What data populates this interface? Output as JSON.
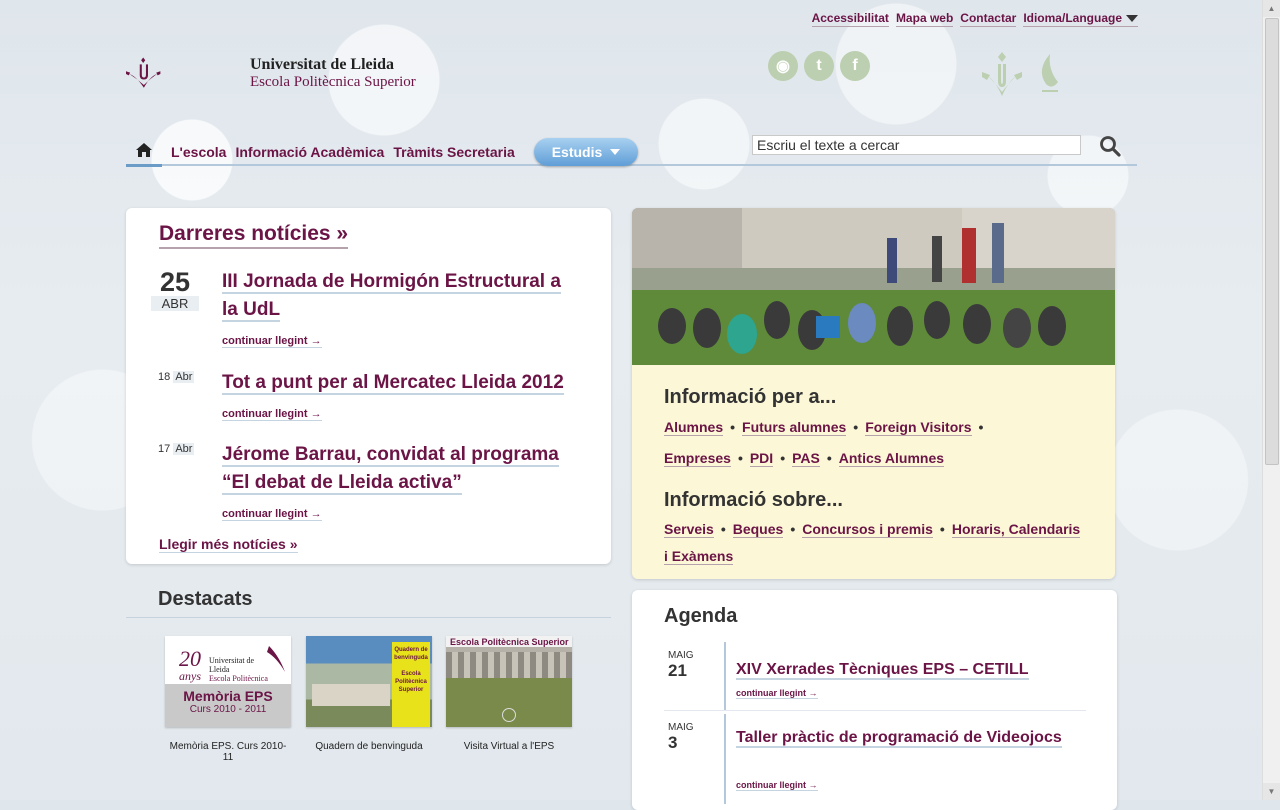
{
  "top_nav": {
    "items": [
      "Accessibilitat",
      "Mapa web",
      "Contactar",
      "Idioma/Language"
    ]
  },
  "logo": {
    "title": "Universitat de Lleida",
    "subtitle": "Escola Politècnica Superior"
  },
  "social": {
    "icons": [
      "rss-icon",
      "twitter-icon",
      "facebook-icon"
    ],
    "rss_glyph": "◉",
    "twitter_glyph": "t",
    "facebook_glyph": "f"
  },
  "main_nav": {
    "items": [
      "L'escola",
      "Informació Acadèmica",
      "Tràmits Secretaria"
    ],
    "estudis_label": "Estudis"
  },
  "search": {
    "value": "Escriu el texte a cercar"
  },
  "news": {
    "heading": "Darreres notícies »",
    "items": [
      {
        "day": "25",
        "month": "ABR",
        "title": "III Jornada de Hormigón Estructural a la UdL",
        "link": "continuar llegint →"
      },
      {
        "day": "18",
        "month": "Abr",
        "title": "Tot a punt per al Mercatec Lleida 2012",
        "link": "continuar llegint →"
      },
      {
        "day": "17",
        "month": "Abr",
        "title": "Jérome Barrau, convidat al programa “El debat de Lleida activa”",
        "link": "continuar llegint →"
      }
    ],
    "more": "Llegir més notícies »"
  },
  "info": {
    "per_heading": "Informació per a...",
    "per_links": [
      "Alumnes",
      "Futurs alumnes",
      "Foreign Visitors",
      "Empreses",
      "PDI",
      "PAS",
      "Antics Alumnes"
    ],
    "sobre_heading": "Informació sobre...",
    "sobre_links": [
      "Serveis",
      "Beques",
      "Concursos i premis",
      "Horaris, Calendaris i Exàmens"
    ]
  },
  "destacats": {
    "heading": "Destacats",
    "items": [
      {
        "caption": "Memòria EPS. Curs 2010-11",
        "img_years": "20",
        "img_anys": "anys",
        "img_title": "Memòria EPS",
        "img_sub": "Curs 2010 - 2011",
        "img_uni": "Universitat de Lleida",
        "img_school": "Escola Politècnica Superior"
      },
      {
        "caption": "Quadern de benvinguda",
        "img_text1": "Quadern de benvinguda",
        "img_text2": "Escola Politècnica Superior"
      },
      {
        "caption": "Visita Virtual a l'EPS",
        "img_text": "Escola Politècnica Superior"
      }
    ]
  },
  "agenda": {
    "heading": "Agenda",
    "items": [
      {
        "month": "MAIG",
        "day": "21",
        "title": "XIV Xerrades Tècniques EPS – CETILL",
        "link": "continuar llegint →"
      },
      {
        "month": "MAIG",
        "day": "3",
        "title": "Taller pràctic de programació de Videojocs",
        "link": "continuar llegint →"
      }
    ]
  },
  "colors": {
    "brand": "#6b1446",
    "accent_blue": "#5f9ed7",
    "info_bg": "#fcf7d6"
  }
}
